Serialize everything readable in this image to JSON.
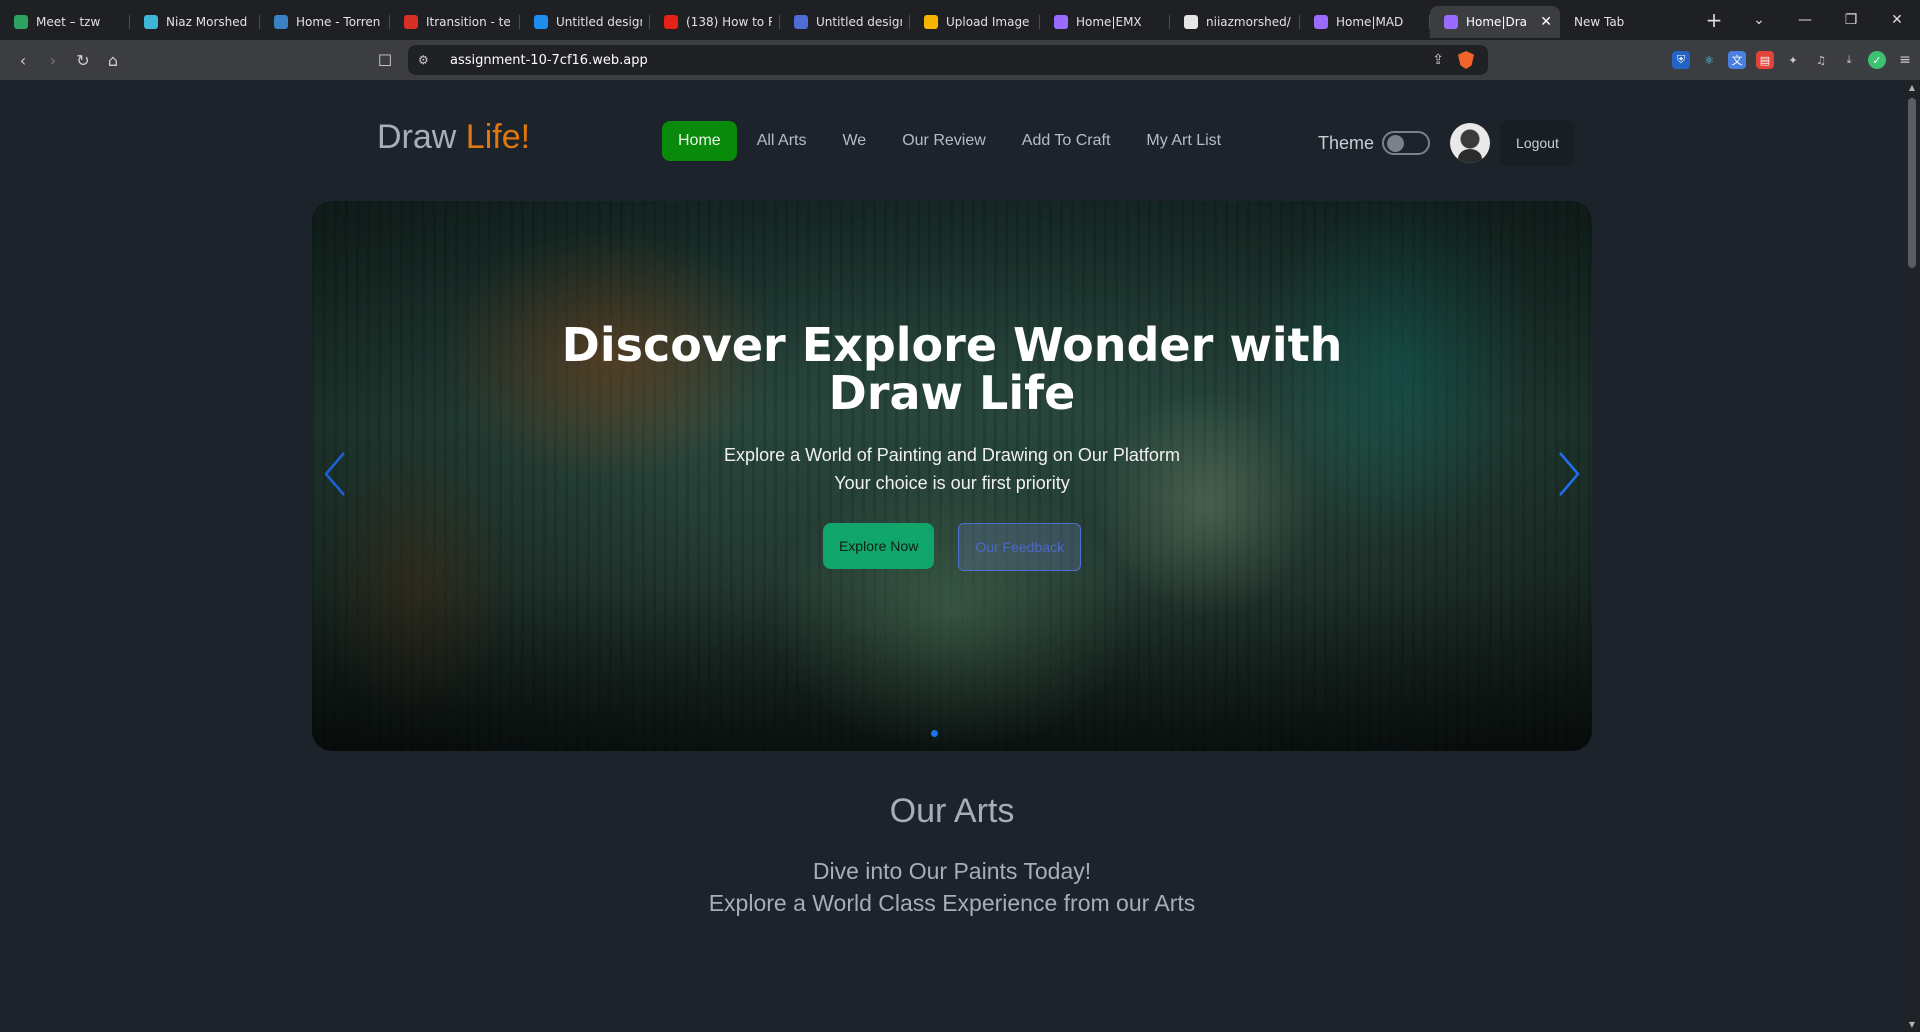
{
  "browser": {
    "tabs": [
      {
        "label": "Meet – tzw",
        "icon": "meet-icon",
        "color": "#2da160"
      },
      {
        "label": "Niaz Morshed",
        "icon": "react-icon",
        "color": "#3fb6d8"
      },
      {
        "label": "Home - Torren",
        "icon": "torrent-icon",
        "color": "#3b82c4"
      },
      {
        "label": "Itransition - te",
        "icon": "gmail-icon",
        "color": "#d93025"
      },
      {
        "label": "Untitled design",
        "icon": "canva-icon",
        "color": "#1f8cf0"
      },
      {
        "label": "(138) How to R",
        "icon": "youtube-icon",
        "color": "#e62117"
      },
      {
        "label": "Untitled design",
        "icon": "doc-icon",
        "color": "#4f6bd6"
      },
      {
        "label": "Upload Image",
        "icon": "upload-icon",
        "color": "#f5b400"
      },
      {
        "label": "Home|EMX",
        "icon": "vite-icon",
        "color": "#9a6bff"
      },
      {
        "label": "niiazmorshed/",
        "icon": "github-icon",
        "color": "#e6e6e6"
      },
      {
        "label": "Home|MAD",
        "icon": "vite-icon",
        "color": "#9a6bff"
      },
      {
        "label": "Home|Dra",
        "icon": "vite-icon",
        "color": "#9a6bff",
        "active": true
      },
      {
        "label": "New Tab",
        "icon": "",
        "color": ""
      }
    ],
    "url": "assignment-10-7cf16.web.app",
    "close_glyph": "✕"
  },
  "site": {
    "logo": {
      "main": "Draw ",
      "accent": "Life!"
    },
    "menu": [
      "Home",
      "All Arts",
      "We",
      "Our Review",
      "Add To Craft",
      "My Art List"
    ],
    "theme_label": "Theme",
    "logout": "Logout",
    "colors": {
      "active_menu": "#0a8a0a",
      "logo_accent": "#e0780f",
      "explore_btn": "#10a56a"
    }
  },
  "hero": {
    "title": "Discover Explore Wonder with Draw Life",
    "subtitle_line1": "Explore a World of Painting and Drawing on Our Platform",
    "subtitle_line2": "Your choice is our first priority",
    "explore_button": "Explore Now",
    "feedback_button": "Our Feedback"
  },
  "section": {
    "title": "Our Arts",
    "line1": "Dive into Our Paints Today!",
    "line2": "Explore a World Class Experience from our Arts"
  }
}
